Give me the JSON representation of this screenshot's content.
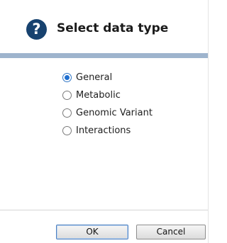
{
  "dialog": {
    "title": "Select data type",
    "icon": "help-icon"
  },
  "options": [
    {
      "label": "General",
      "checked": true
    },
    {
      "label": "Metabolic",
      "checked": false
    },
    {
      "label": "Genomic Variant",
      "checked": false
    },
    {
      "label": "Interactions",
      "checked": false
    }
  ],
  "buttons": {
    "ok_label": "OK",
    "cancel_label": "Cancel"
  },
  "colors": {
    "icon_bg": "#17426f",
    "divider": "#9eb4cd",
    "radio_selected": "#1f6fd0"
  }
}
